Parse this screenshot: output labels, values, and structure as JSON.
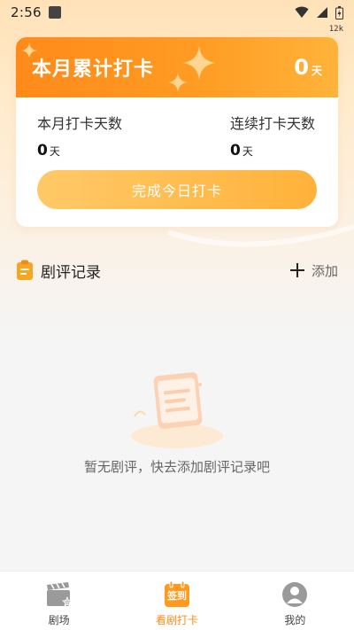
{
  "status_bar": {
    "time": "2:56",
    "speed": "12k"
  },
  "card": {
    "title": "本月累计打卡",
    "total_count": "0",
    "total_unit": "天",
    "stats": [
      {
        "label": "本月打卡天数",
        "value": "0",
        "unit": "天"
      },
      {
        "label": "连续打卡天数",
        "value": "0",
        "unit": "天"
      }
    ],
    "button_label": "完成今日打卡"
  },
  "section": {
    "title": "剧评记录",
    "add_label": "添加"
  },
  "empty_state": {
    "text": "暂无剧评，快去添加剧评记录吧"
  },
  "bottom_nav": {
    "items": [
      {
        "label": "剧场",
        "icon": "clapperboard-icon",
        "active": false
      },
      {
        "label": "看剧打卡",
        "icon": "calendar-checkin-icon",
        "active": true,
        "badge": "签到"
      },
      {
        "label": "我的",
        "icon": "profile-icon",
        "active": false
      }
    ]
  },
  "colors": {
    "accent": "#ff8c1a",
    "button_gradient_start": "#ffc968",
    "button_gradient_end": "#ffb23a",
    "inactive_icon": "#9a9a9a"
  }
}
